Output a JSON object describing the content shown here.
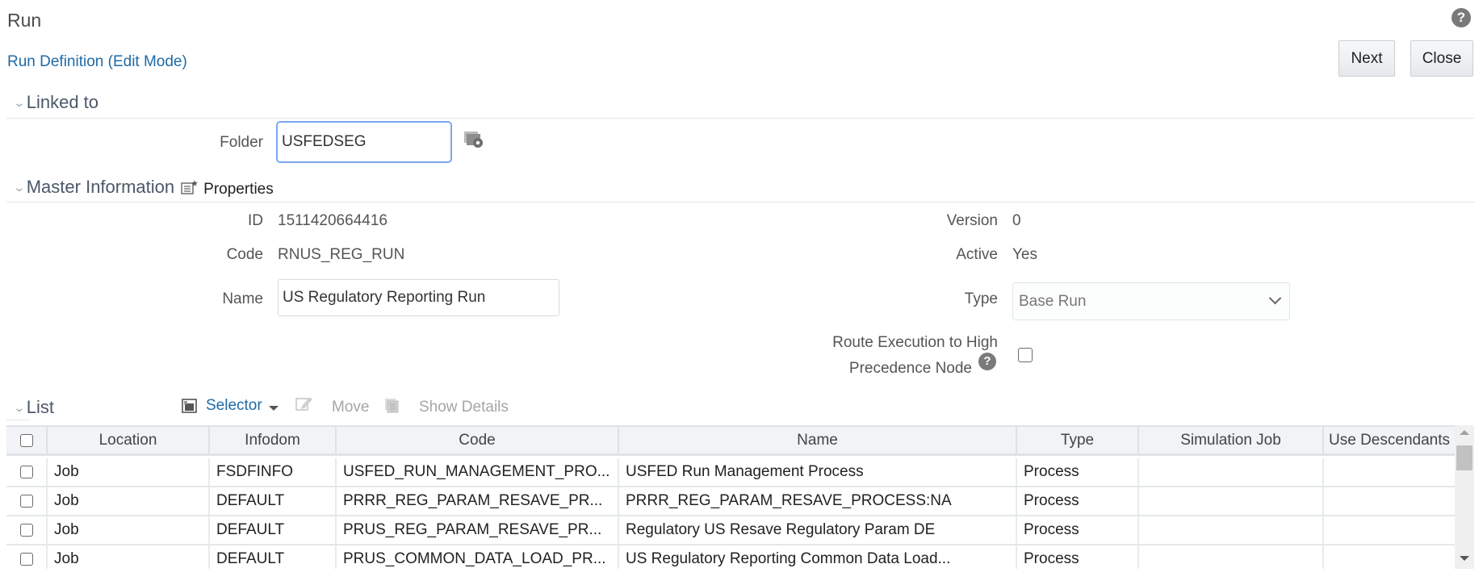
{
  "header": {
    "title": "Run",
    "help_icon": "question-circle-icon",
    "subtitle": "Run Definition (Edit Mode)",
    "buttons": {
      "next": "Next",
      "close": "Close"
    }
  },
  "linked_to": {
    "section_title": "Linked to",
    "folder_label": "Folder",
    "folder_value": "USFEDSEG",
    "folder_browse_icon": "folder-settings-icon"
  },
  "master_information": {
    "section_title": "Master Information",
    "properties_icon": "edit-properties-icon",
    "properties_label": "Properties",
    "id_label": "ID",
    "id_value": "1511420664416",
    "code_label": "Code",
    "code_value": "RNUS_REG_RUN",
    "name_label": "Name",
    "name_value": "US Regulatory Reporting Run",
    "version_label": "Version",
    "version_value": "0",
    "active_label": "Active",
    "active_value": "Yes",
    "type_label": "Type",
    "type_value": "Base Run",
    "route_label_line1": "Route Execution to High",
    "route_label_line2": "Precedence Node",
    "route_checked": false
  },
  "list": {
    "section_title": "List",
    "toolbar": {
      "selector": "Selector",
      "move": "Move",
      "show_details": "Show Details"
    },
    "columns": [
      "Location",
      "Infodom",
      "Code",
      "Name",
      "Type",
      "Simulation Job",
      "Use Descendants"
    ],
    "rows": [
      {
        "location": "Job",
        "infodom": "FSDFINFO",
        "code": "USFED_RUN_MANAGEMENT_PRO...",
        "name": "USFED Run Management Process",
        "type": "Process",
        "simulation_job": "",
        "use_descendants": ""
      },
      {
        "location": "Job",
        "infodom": "DEFAULT",
        "code": "PRRR_REG_PARAM_RESAVE_PR...",
        "name": "PRRR_REG_PARAM_RESAVE_PROCESS:NA",
        "type": "Process",
        "simulation_job": "",
        "use_descendants": ""
      },
      {
        "location": "Job",
        "infodom": "DEFAULT",
        "code": "PRUS_REG_PARAM_RESAVE_PR...",
        "name": "Regulatory US Resave Regulatory Param DE",
        "type": "Process",
        "simulation_job": "",
        "use_descendants": ""
      },
      {
        "location": "Job",
        "infodom": "DEFAULT",
        "code": "PRUS_COMMON_DATA_LOAD_PR...",
        "name": "US Regulatory Reporting Common Data Load...",
        "type": "Process",
        "simulation_job": "",
        "use_descendants": ""
      }
    ]
  },
  "colors": {
    "link_blue": "#1f6aa5",
    "section_title": "#4a5868",
    "focus_border": "#7aa7f2",
    "table_header_bg": "#f1f3f6",
    "disabled_text": "#a6a6a6"
  }
}
